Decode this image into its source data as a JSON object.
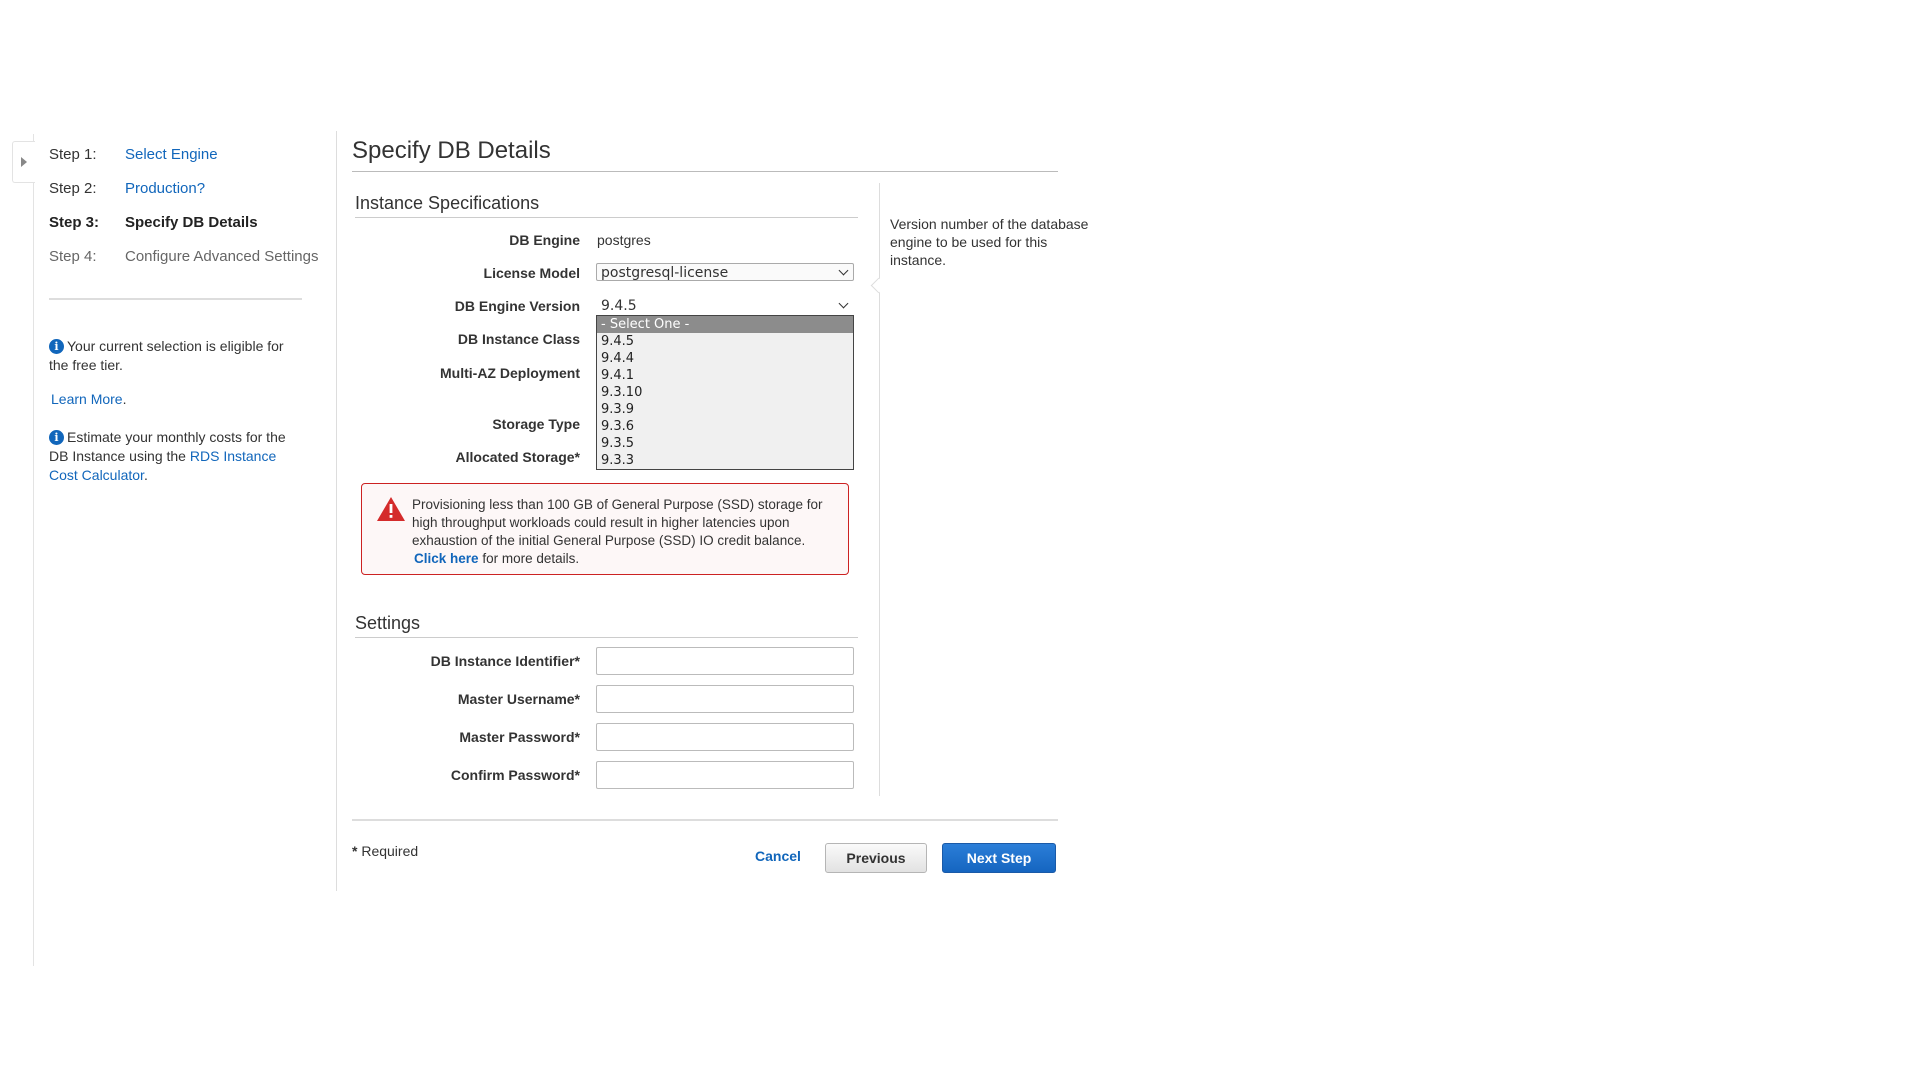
{
  "steps": [
    {
      "number": "Step 1:",
      "label": "Select Engine",
      "state": "link"
    },
    {
      "number": "Step 2:",
      "label": "Production?",
      "state": "link"
    },
    {
      "number": "Step 3:",
      "label": "Specify DB Details",
      "state": "current"
    },
    {
      "number": "Step 4:",
      "label": "Configure Advanced Settings",
      "state": "future"
    }
  ],
  "sidebar": {
    "free_tier_text": "Your current selection is eligible for the free tier.",
    "learn_more": "Learn More",
    "estimate_text": "Estimate your monthly costs for the DB Instance using the",
    "calculator_link": "RDS Instance Cost Calculator",
    "period": "."
  },
  "page_title": "Specify DB Details",
  "instance_specs": {
    "title": "Instance Specifications",
    "db_engine_label": "DB Engine",
    "db_engine_value": "postgres",
    "license_model_label": "License Model",
    "license_model_value": "postgresql-license",
    "engine_version_label": "DB Engine Version",
    "engine_version_value": "9.4.5",
    "instance_class_label": "DB Instance Class",
    "multi_az_label": "Multi-AZ Deployment",
    "storage_type_label": "Storage Type",
    "allocated_storage_label": "Allocated Storage*"
  },
  "version_options": [
    "- Select One -",
    "9.4.5",
    "9.4.4",
    "9.4.1",
    "9.3.10",
    "9.3.9",
    "9.3.6",
    "9.3.5",
    "9.3.3"
  ],
  "warning": {
    "text": "Provisioning less than 100 GB of General Purpose (SSD) storage for high throughput workloads could result in higher latencies upon exhaustion of the initial General Purpose (SSD) IO credit balance.",
    "link": "Click here",
    "suffix": "for more details."
  },
  "help_text": "Version number of the database engine to be used for this instance.",
  "settings": {
    "title": "Settings",
    "identifier_label": "DB Instance Identifier*",
    "username_label": "Master Username*",
    "password_label": "Master Password*",
    "confirm_label": "Confirm Password*"
  },
  "footer": {
    "required_star": "*",
    "required_text": " Required",
    "cancel": "Cancel",
    "previous": "Previous",
    "next": "Next Step"
  },
  "colors": {
    "link": "#1166bb",
    "primary_button": "#1565c0",
    "warning_border": "#cc2222"
  }
}
